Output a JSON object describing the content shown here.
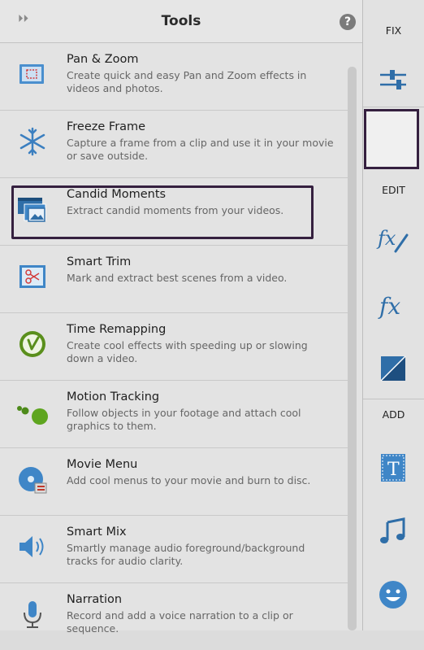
{
  "header": {
    "title": "Tools",
    "help": "?",
    "collapse": "⏵⏵"
  },
  "items": [
    {
      "name": "Pan & Zoom",
      "desc": "Create quick and easy Pan and Zoom effects in videos and photos.",
      "icon": "pan-zoom-icon"
    },
    {
      "name": "Freeze Frame",
      "desc": "Capture a frame from a clip and use it in your movie or save outside.",
      "icon": "freeze-frame-icon"
    },
    {
      "name": "Candid Moments",
      "desc": "Extract candid moments from your videos.",
      "icon": "candid-moments-icon"
    },
    {
      "name": "Smart Trim",
      "desc": "Mark and extract best scenes from a video.",
      "icon": "smart-trim-icon"
    },
    {
      "name": "Time Remapping",
      "desc": "Create cool effects with speeding up or slowing down a video.",
      "icon": "time-remapping-icon"
    },
    {
      "name": "Motion Tracking",
      "desc": "Follow objects in your footage and attach cool graphics to them.",
      "icon": "motion-tracking-icon"
    },
    {
      "name": "Movie Menu",
      "desc": "Add cool menus to your movie and burn to disc.",
      "icon": "movie-menu-icon"
    },
    {
      "name": "Smart Mix",
      "desc": "Smartly manage audio foreground/background tracks for audio clarity.",
      "icon": "smart-mix-icon"
    },
    {
      "name": "Narration",
      "desc": "Record and add a voice narration to a clip or sequence.",
      "icon": "narration-icon"
    }
  ],
  "rightbar": {
    "fix_label": "FIX",
    "edit_label": "EDIT",
    "add_label": "ADD"
  }
}
